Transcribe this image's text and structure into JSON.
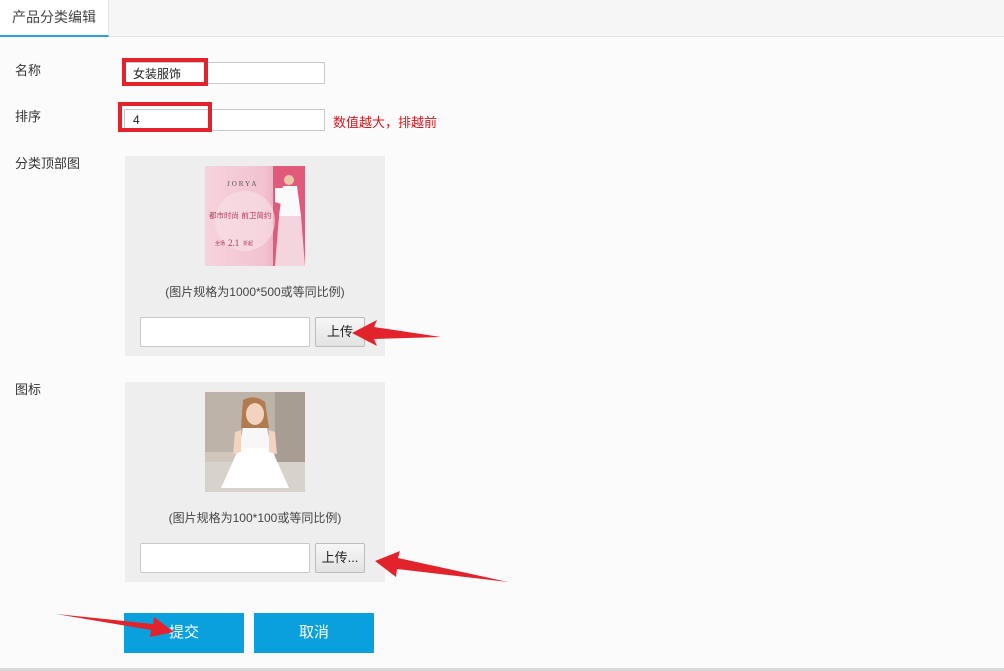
{
  "tab": {
    "label": "产品分类编辑"
  },
  "form": {
    "name_label": "名称",
    "name_value": "女装服饰",
    "sort_label": "排序",
    "sort_value": "4",
    "sort_hint": "数值越大，排越前",
    "top_image_label": "分类顶部图",
    "top_image_caption": "(图片规格为1000*500或等同比例)",
    "top_image_upload": "上传",
    "icon_label": "图标",
    "icon_caption": "(图片规格为100*100或等同比例)",
    "icon_upload": "上传..."
  },
  "banner": {
    "brand": "JORYA",
    "tagline": "都市时尚 前卫简约",
    "promo_prefix": "全场",
    "promo_number": "2.1",
    "promo_suffix": "折起"
  },
  "buttons": {
    "submit": "提交",
    "cancel": "取消"
  },
  "colors": {
    "accent": "#0aa0de",
    "highlight": "#e3232b",
    "hint": "#d9171e"
  }
}
